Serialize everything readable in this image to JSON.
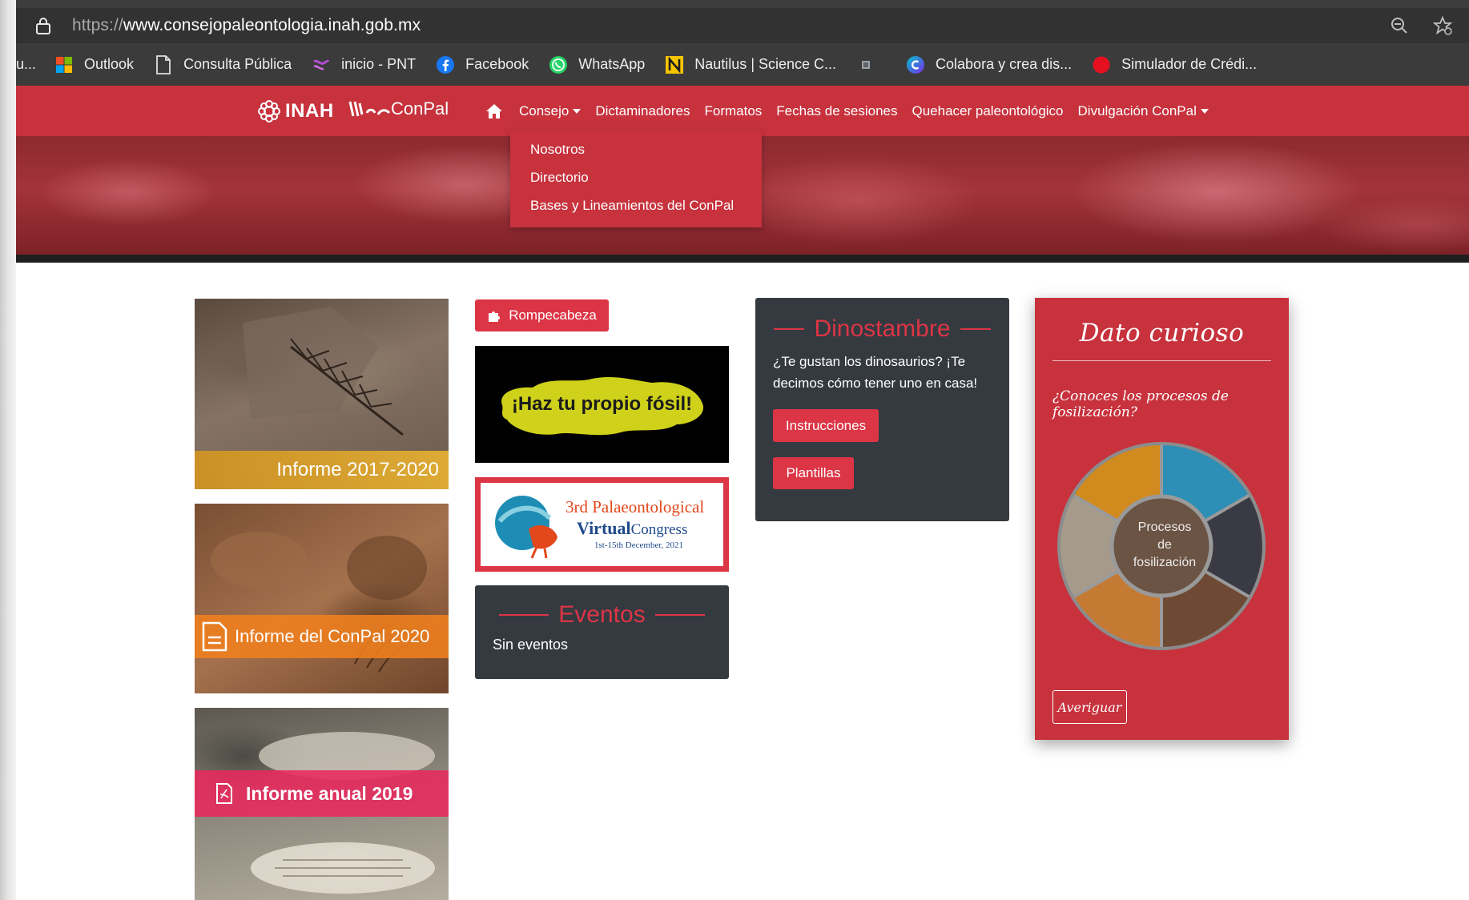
{
  "browser": {
    "url_prefix": "https://",
    "url_host": "www.consejopaleontologia.inah.gob.mx",
    "bookmarks": [
      {
        "label": "u...",
        "icon": "truncated"
      },
      {
        "label": "Outlook",
        "icon": "microsoft-icon"
      },
      {
        "label": "Consulta Pública",
        "icon": "document-icon"
      },
      {
        "label": "inicio - PNT",
        "icon": "pnt-icon"
      },
      {
        "label": "Facebook",
        "icon": "facebook-icon"
      },
      {
        "label": "WhatsApp",
        "icon": "whatsapp-icon"
      },
      {
        "label": "Nautilus | Science C...",
        "icon": "nautilus-icon"
      },
      {
        "label": "",
        "icon": "small-favicon-icon"
      },
      {
        "label": "Colabora y crea dis...",
        "icon": "canva-icon"
      },
      {
        "label": "Simulador de Crédi...",
        "icon": "red-circle-icon"
      }
    ]
  },
  "nav": {
    "logo_inah": "INAH",
    "logo_conpal": "ConPal",
    "items": [
      "Consejo",
      "Dictaminadores",
      "Formatos",
      "Fechas de sesiones",
      "Quehacer paleontológico",
      "Divulgación ConPal"
    ]
  },
  "dropdown": {
    "items": [
      "Nosotros",
      "Directorio",
      "Bases y Lineamientos del ConPal"
    ]
  },
  "reports": {
    "report1": "Informe 2017-2020",
    "report2": "Informe del ConPal 2020",
    "report3": "Informe anual 2019"
  },
  "middle": {
    "puzzle_button": "Rompecabeza",
    "fossil_banner": "¡Haz tu propio fósil!",
    "congress_line1": "3rd Palaeontological",
    "congress_line2_a": "Virtual",
    "congress_line2_b": "Congress",
    "congress_line3": "1st-15th December, 2021",
    "eventos_title": "Eventos",
    "eventos_text": "Sin eventos"
  },
  "dinostambre": {
    "title": "Dinostambre",
    "text": "¿Te gustan los dinosaurios? ¡Te decimos cómo tener uno en casa!",
    "btn_instrucciones": "Instrucciones",
    "btn_plantillas": "Plantillas"
  },
  "curioso": {
    "title": "Dato curioso",
    "question": "¿Conoces los procesos de fosilización?",
    "wheel_center": [
      "Procesos",
      "de",
      "fosilización"
    ],
    "button": "Averiguar"
  },
  "colors": {
    "brand_red": "#c7323d",
    "button_red": "#dc3545",
    "dark_card": "#343a40",
    "chrome_dark": "#323232"
  }
}
